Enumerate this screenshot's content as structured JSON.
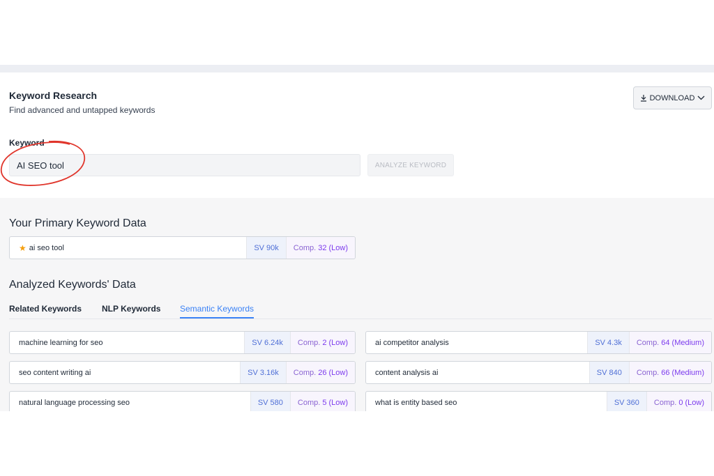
{
  "header": {
    "title": "Keyword Research",
    "subtitle": "Find advanced and untapped keywords",
    "download_label": "DOWNLOAD",
    "download_icon": "download-icon",
    "dropdown_icon": "chevron-down-icon"
  },
  "keyword": {
    "label": "Keyword",
    "value": "AI SEO tool",
    "analyze_label": "ANALYZE KEYWORD"
  },
  "primary": {
    "heading": "Your Primary Keyword Data",
    "keyword": "ai seo tool",
    "sv": "SV 90k",
    "comp_prefix": "Comp.",
    "comp_value": "32 (Low)",
    "icon": "star-icon"
  },
  "analyzed": {
    "heading": "Analyzed Keywords' Data",
    "tabs": [
      {
        "label": "Related Keywords",
        "active": false
      },
      {
        "label": "NLP Keywords",
        "active": false
      },
      {
        "label": "Semantic Keywords",
        "active": true
      }
    ],
    "rows": [
      {
        "keyword": "machine learning for seo",
        "sv": "SV 6.24k",
        "comp_prefix": "Comp.",
        "comp_value": "2 (Low)"
      },
      {
        "keyword": "ai competitor analysis",
        "sv": "SV 4.3k",
        "comp_prefix": "Comp.",
        "comp_value": "64 (Medium)"
      },
      {
        "keyword": "seo content writing ai",
        "sv": "SV 3.16k",
        "comp_prefix": "Comp.",
        "comp_value": "26 (Low)"
      },
      {
        "keyword": "content analysis ai",
        "sv": "SV 840",
        "comp_prefix": "Comp.",
        "comp_value": "66 (Medium)"
      },
      {
        "keyword": "natural language processing seo",
        "sv": "SV 580",
        "comp_prefix": "Comp.",
        "comp_value": "5 (Low)"
      },
      {
        "keyword": "what is entity based seo",
        "sv": "SV 360",
        "comp_prefix": "Comp.",
        "comp_value": "0 (Low)"
      }
    ]
  },
  "colors": {
    "accent": "#3b82f6",
    "sv_text": "#4f6fd6",
    "comp_text": "#7c3aed",
    "annotation": "#e0352b"
  }
}
